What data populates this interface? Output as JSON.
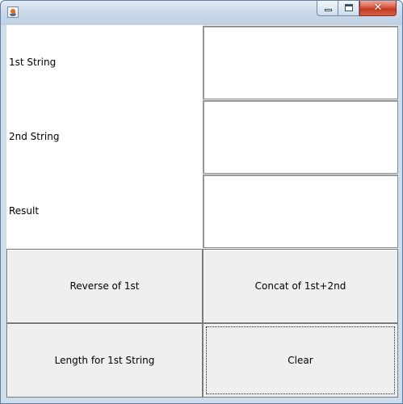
{
  "window": {
    "icon": "java-icon",
    "controls": {
      "minimize": "minimize-icon",
      "maximize": "maximize-icon",
      "close": "close-icon"
    },
    "close_glyph": "✕"
  },
  "form": {
    "first_label": "1st String",
    "second_label": "2nd String",
    "result_label": "Result",
    "first_value": "",
    "second_value": "",
    "result_value": ""
  },
  "buttons": {
    "reverse": "Reverse of 1st",
    "concat": "Concat of 1st+2nd",
    "length": "Length for 1st String",
    "clear": "Clear"
  }
}
